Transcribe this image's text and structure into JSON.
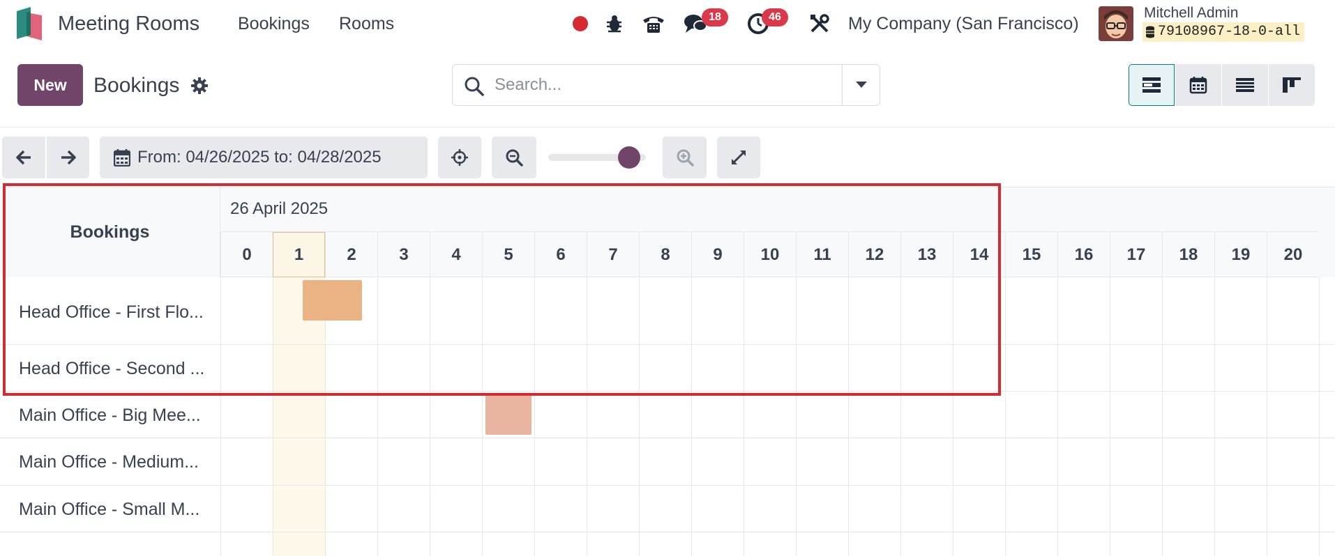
{
  "navbar": {
    "app_name": "Meeting Rooms",
    "menu": [
      "Bookings",
      "Rooms"
    ],
    "messages_count": "18",
    "activities_count": "46",
    "company": "My Company (San Francisco)",
    "user_name": "Mitchell Admin",
    "database": "79108967-18-0-all"
  },
  "control_panel": {
    "new_label": "New",
    "title": "Bookings",
    "search_placeholder": "Search..."
  },
  "toolbar": {
    "range_label": "From: 04/26/2025 to: 04/28/2025",
    "zoom_level": 0.83
  },
  "gantt": {
    "title": "Bookings",
    "date_label": "26 April 2025",
    "hours": [
      "0",
      "1",
      "2",
      "3",
      "4",
      "5",
      "6",
      "7",
      "8",
      "9",
      "10",
      "11",
      "12",
      "13",
      "14",
      "15",
      "16",
      "17",
      "18",
      "19",
      "20"
    ],
    "today_hour": "1",
    "rows": [
      {
        "label": "Head Office - First Flo..."
      },
      {
        "label": "Head Office - Second ..."
      },
      {
        "label": "Main Office - Big Mee..."
      },
      {
        "label": "Main Office - Medium..."
      },
      {
        "label": "Main Office - Small M..."
      }
    ],
    "bookings": [
      {
        "row": 0,
        "start_hour": 1.57,
        "end_hour": 2.7,
        "color": "#e9b384"
      },
      {
        "row": 2,
        "start_hour": 5.07,
        "end_hour": 5.95,
        "color": "#eab5a0"
      }
    ]
  },
  "colors": {
    "brand": "#71456a",
    "accent": "#017e84",
    "badge": "#d9394a",
    "highlight": "#d42a31"
  }
}
